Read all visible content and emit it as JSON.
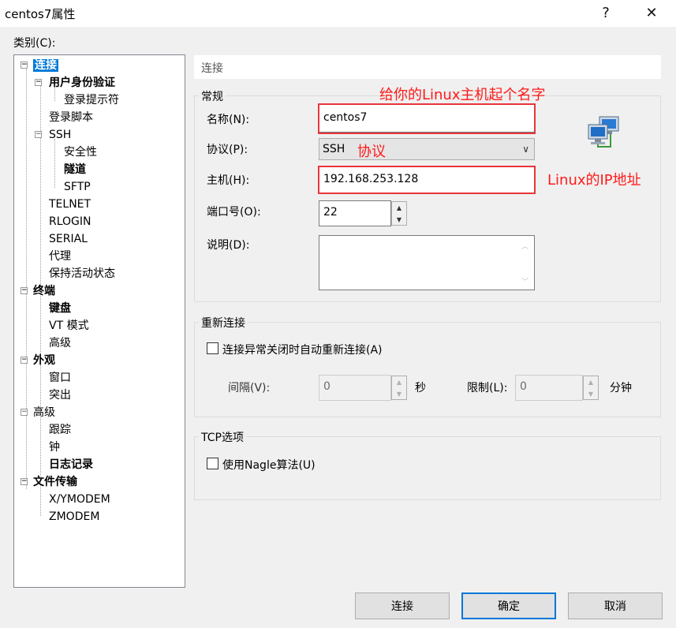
{
  "window": {
    "title": "centos7属性",
    "help_button": "?",
    "close_button": "✕"
  },
  "category_label": "类别(C):",
  "tree": {
    "connection": "连接",
    "auth": "用户身份验证",
    "login_prompt": "登录提示符",
    "login_script": "登录脚本",
    "ssh": "SSH",
    "security": "安全性",
    "tunnel": "隧道",
    "sftp": "SFTP",
    "telnet": "TELNET",
    "rlogin": "RLOGIN",
    "serial": "SERIAL",
    "proxy": "代理",
    "keepalive": "保持活动状态",
    "terminal": "终端",
    "keyboard": "键盘",
    "vt_mode": "VT 模式",
    "advanced_term": "高级",
    "appearance": "外观",
    "window": "窗口",
    "highlight": "突出",
    "advanced": "高级",
    "trace": "跟踪",
    "bell": "钟",
    "log": "日志记录",
    "file_transfer": "文件传输",
    "xymodem": "X/YMODEM",
    "zmodem": "ZMODEM"
  },
  "header": "连接",
  "general": {
    "title": "常规",
    "name_label": "名称(N):",
    "name_value": "centos7",
    "protocol_label": "协议(P):",
    "protocol_value": "SSH",
    "host_label": "主机(H):",
    "host_value": "192.168.253.128",
    "port_label": "端口号(O):",
    "port_value": "22",
    "desc_label": "说明(D):",
    "desc_value": ""
  },
  "reconnect": {
    "title": "重新连接",
    "checkbox_label": "连接异常关闭时自动重新连接(A)",
    "checked": false,
    "interval_label": "间隔(V):",
    "interval_value": "0",
    "interval_unit": "秒",
    "limit_label": "限制(L):",
    "limit_value": "0",
    "limit_unit": "分钟"
  },
  "tcp": {
    "title": "TCP选项",
    "nagle_label": "使用Nagle算法(U)",
    "checked": false
  },
  "buttons": {
    "connect": "连接",
    "ok": "确定",
    "cancel": "取消"
  },
  "annotations": {
    "name_hint": "给你的Linux主机起个名字",
    "protocol_hint": "协议",
    "host_hint": "Linux的IP地址"
  },
  "colors": {
    "accent": "#0078d7",
    "annotation": "#ff1a1a"
  },
  "icons": {
    "expander": "minus-box",
    "session": "computers-network-icon"
  }
}
